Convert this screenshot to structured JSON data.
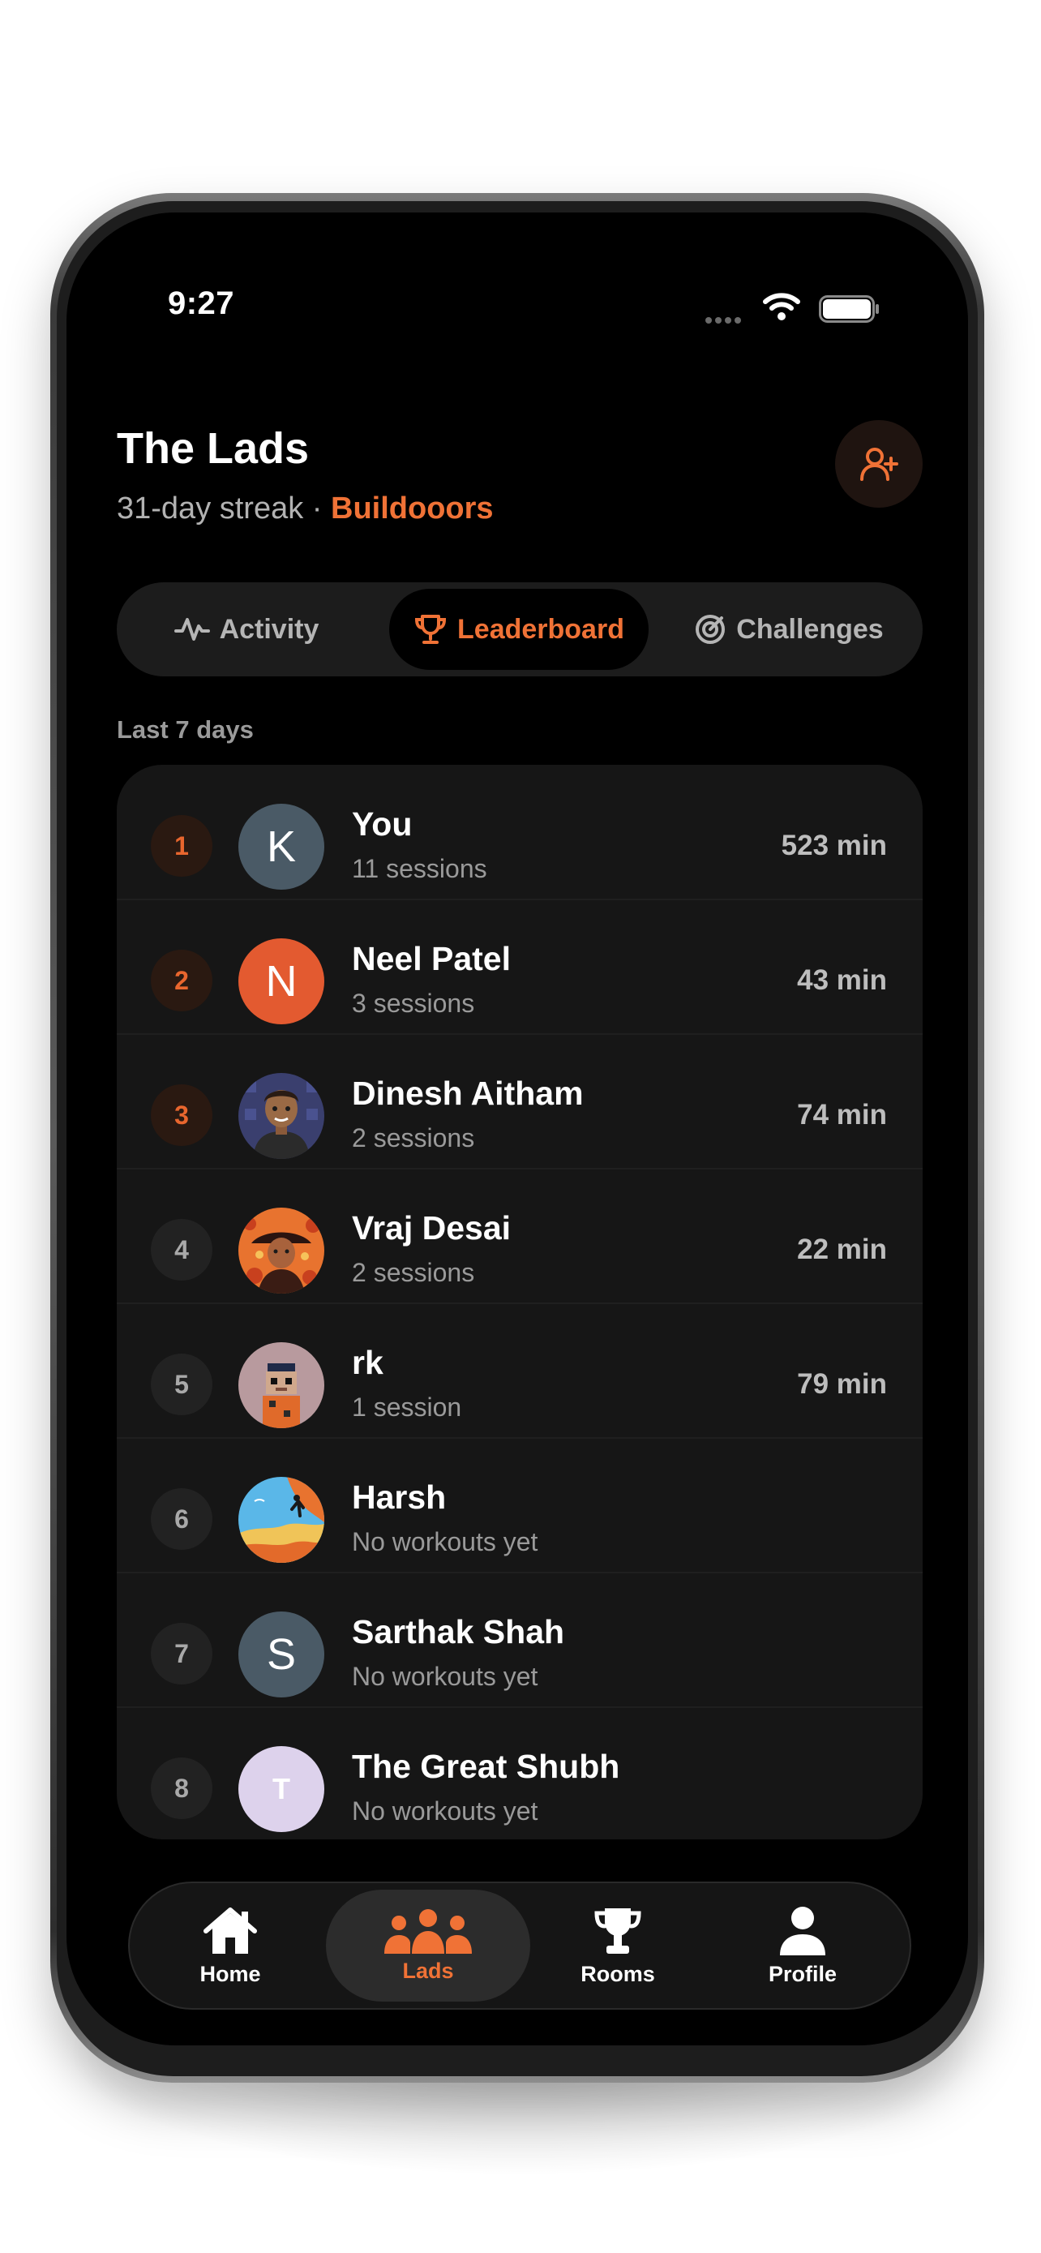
{
  "status_bar": {
    "time": "9:27"
  },
  "header": {
    "title": "The Lads",
    "streak": "31-day streak",
    "separator": " · ",
    "team_name": "Buildooors"
  },
  "segments": [
    {
      "label": "Activity",
      "icon": "activity-pulse-icon",
      "active": false
    },
    {
      "label": "Leaderboard",
      "icon": "trophy-icon",
      "active": true
    },
    {
      "label": "Challenges",
      "icon": "target-icon",
      "active": false
    }
  ],
  "section_label": "Last 7 days",
  "leaderboard": [
    {
      "rank": "1",
      "initial": "K",
      "avatar_color": "#4a5a66",
      "name": "You",
      "sessions": "11 sessions",
      "minutes": "523 min"
    },
    {
      "rank": "2",
      "initial": "N",
      "avatar_color": "#e35a30",
      "name": "Neel Patel",
      "sessions": "3 sessions",
      "minutes": "43 min"
    },
    {
      "rank": "3",
      "initial": "",
      "avatar_color": "#3a3f6e",
      "name": "Dinesh Aitham",
      "sessions": "2 sessions",
      "minutes": "74 min"
    },
    {
      "rank": "4",
      "initial": "",
      "avatar_color": "#e8732f",
      "name": "Vraj Desai",
      "sessions": "2 sessions",
      "minutes": "22 min"
    },
    {
      "rank": "5",
      "initial": "",
      "avatar_color": "#b89a9e",
      "name": "rk",
      "sessions": "1 session",
      "minutes": "79 min"
    },
    {
      "rank": "6",
      "initial": "",
      "avatar_color": "#59b7e8",
      "name": "Harsh",
      "sessions": "No workouts yet",
      "minutes": ""
    },
    {
      "rank": "7",
      "initial": "S",
      "avatar_color": "#4a5a66",
      "name": "Sarthak Shah",
      "sessions": "No workouts yet",
      "minutes": ""
    },
    {
      "rank": "8",
      "initial": "T",
      "avatar_color": "#ddd2ec",
      "name": "The Great Shubh",
      "sessions": "No workouts yet",
      "minutes": ""
    }
  ],
  "tabbar": [
    {
      "label": "Home",
      "icon": "home-icon",
      "active": false
    },
    {
      "label": "Lads",
      "icon": "group-icon",
      "active": true
    },
    {
      "label": "Rooms",
      "icon": "trophy-icon",
      "active": false
    },
    {
      "label": "Profile",
      "icon": "person-icon",
      "active": false
    }
  ],
  "colors": {
    "accent": "#f07236",
    "background": "#000000",
    "card": "#161616"
  }
}
